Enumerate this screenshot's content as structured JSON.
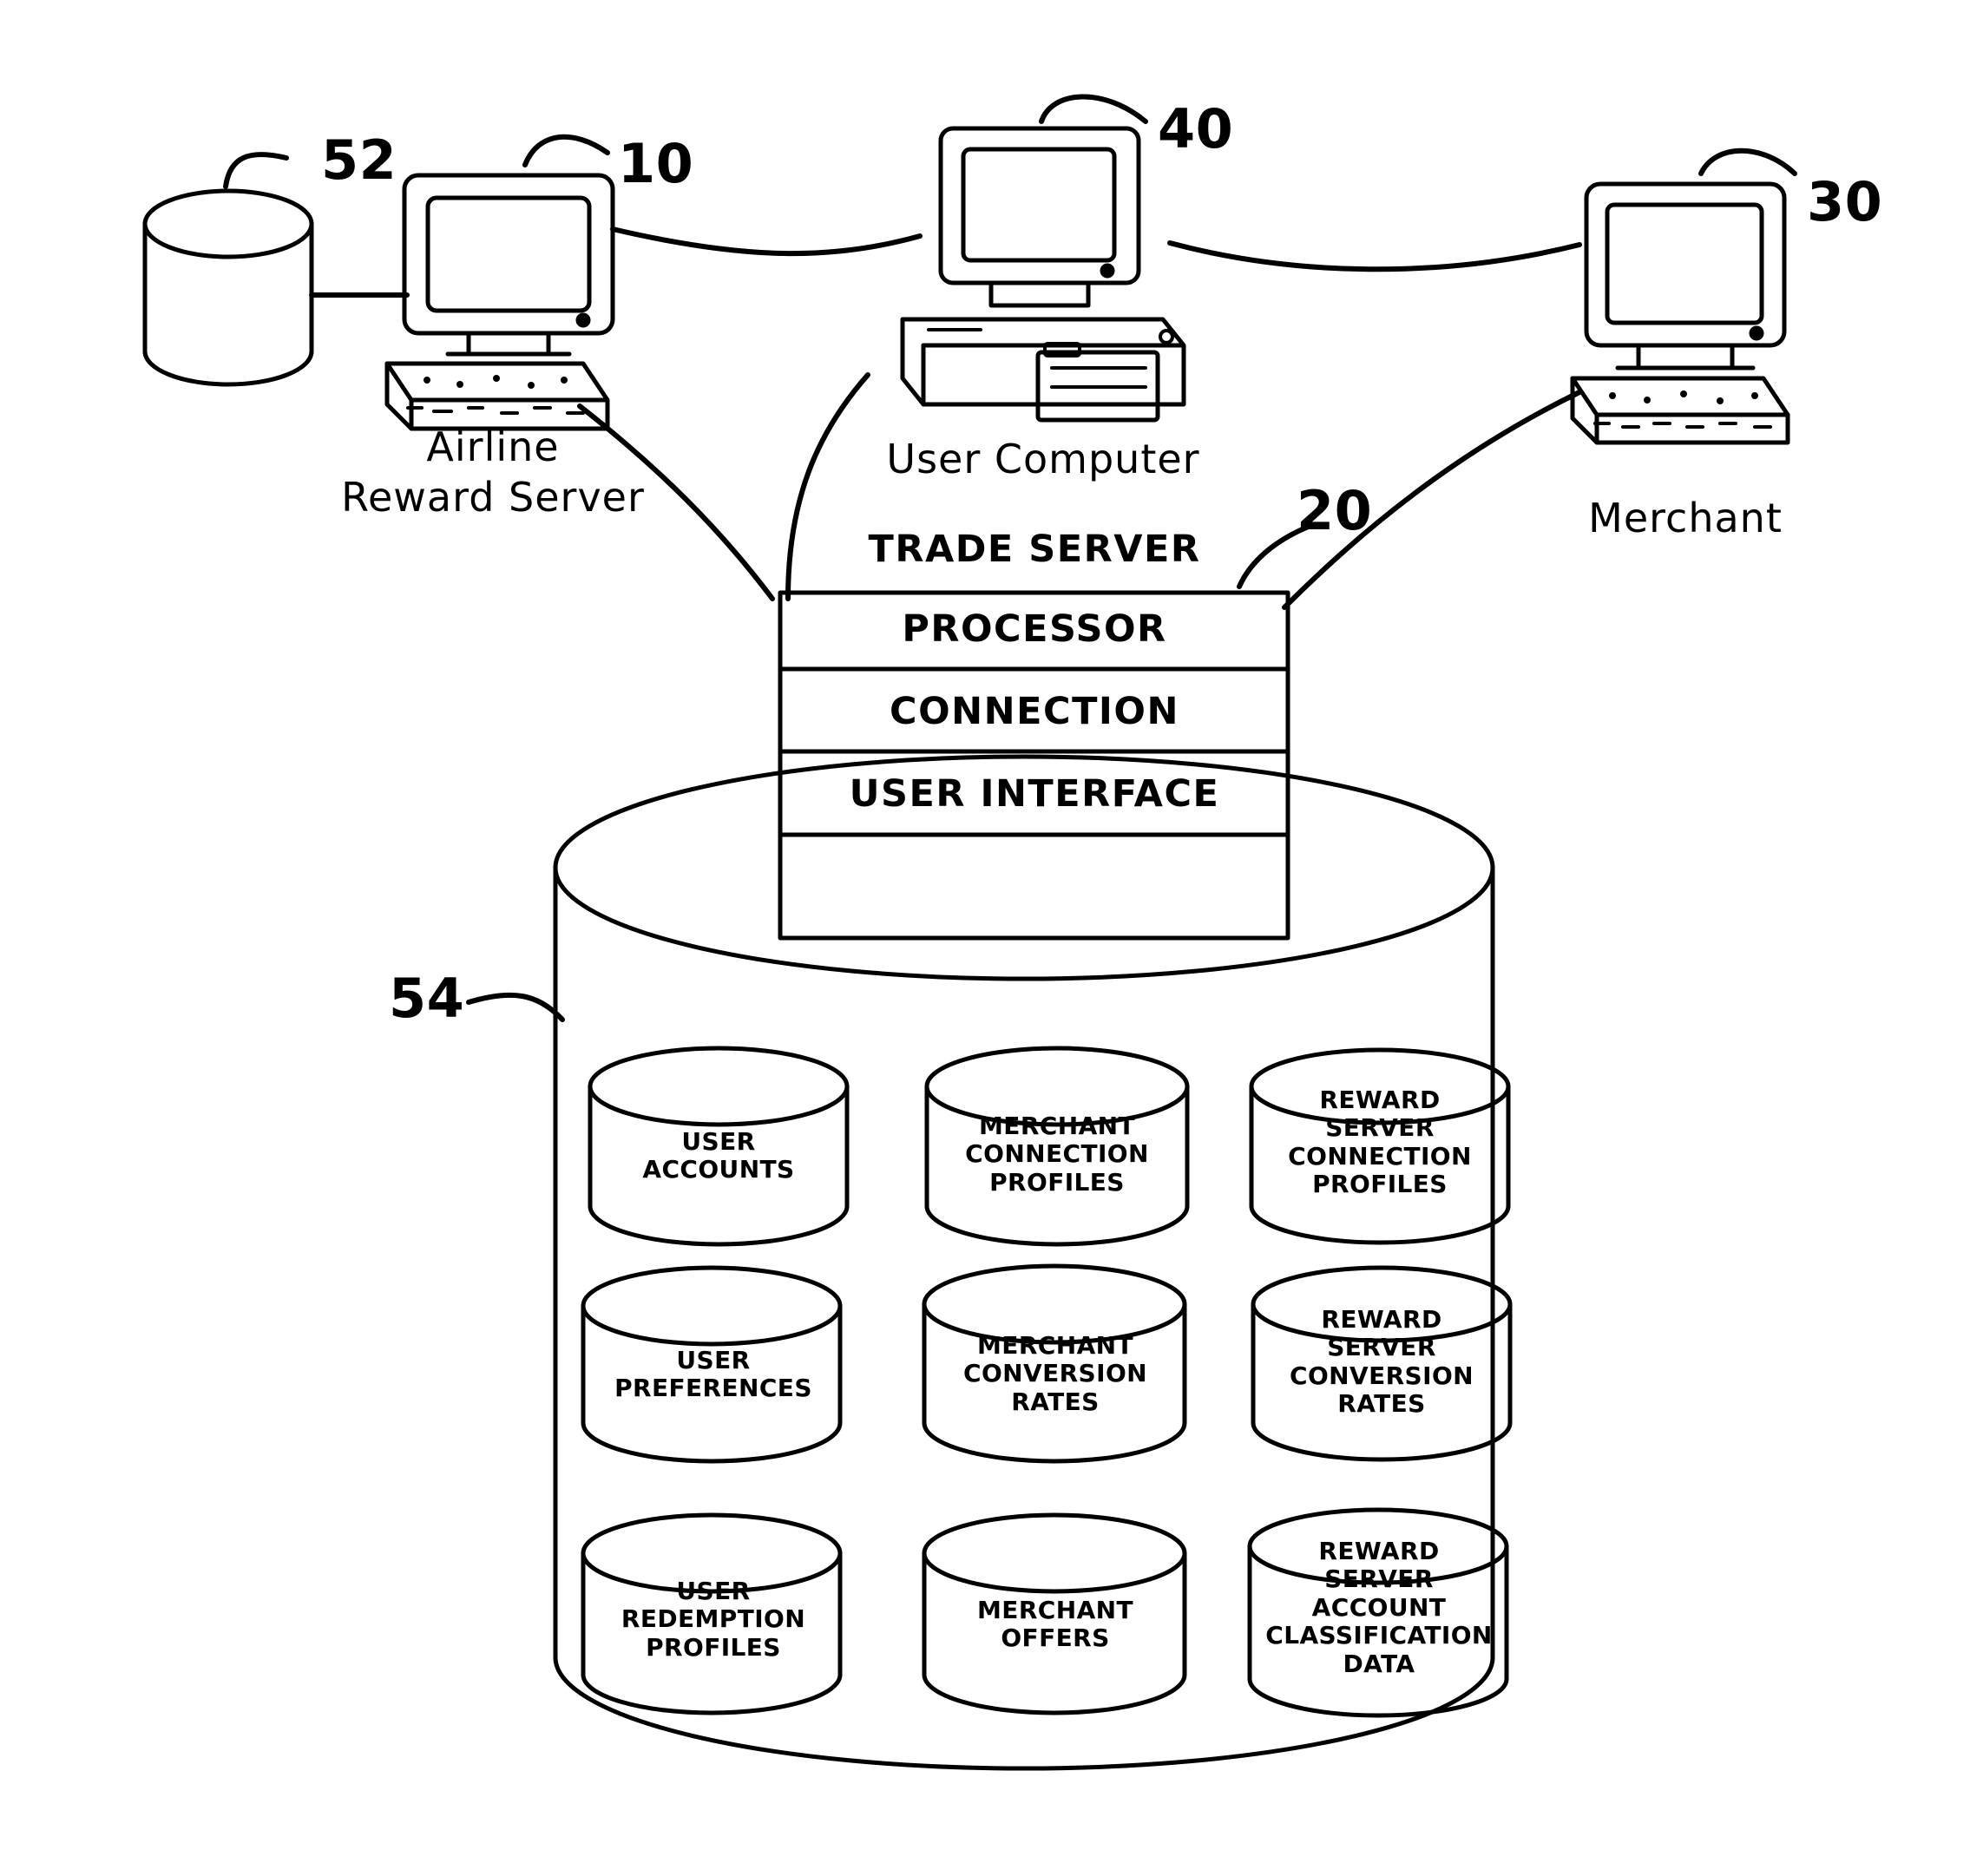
{
  "figure": {
    "type": "patent-system-diagram",
    "nodes": [
      {
        "id": "airline_db",
        "ref": "52",
        "label": "",
        "shape": "database-cylinder"
      },
      {
        "id": "airline_server",
        "ref": "10",
        "label": "Airline\nReward Server",
        "shape": "desktop-computer"
      },
      {
        "id": "user_computer",
        "ref": "40",
        "label": "User Computer",
        "shape": "tower-computer"
      },
      {
        "id": "merchant",
        "ref": "30",
        "label": "Merchant",
        "shape": "desktop-computer"
      },
      {
        "id": "trade_server",
        "ref": "20",
        "label": "TRADE SERVER",
        "shape": "stacked-box"
      },
      {
        "id": "trade_db",
        "ref": "54",
        "label": "",
        "shape": "large-database-cylinder"
      }
    ]
  },
  "refs": {
    "airline_db": "52",
    "airline_server": "10",
    "user_computer": "40",
    "merchant": "30",
    "trade_server": "20",
    "trade_database": "54"
  },
  "device_labels": {
    "airline_reward_server_line1": "Airline",
    "airline_reward_server_line2": "Reward Server",
    "user_computer": "User Computer",
    "merchant": "Merchant"
  },
  "trade_server": {
    "title": "TRADE SERVER",
    "rows": [
      "PROCESSOR",
      "CONNECTION",
      "USER INTERFACE"
    ]
  },
  "database_stores": [
    {
      "id": "user-accounts",
      "lines": [
        "USER",
        "ACCOUNTS"
      ]
    },
    {
      "id": "merchant-connection-profiles",
      "lines": [
        "MERCHANT",
        "CONNECTION",
        "PROFILES"
      ]
    },
    {
      "id": "reward-server-connection-profiles",
      "lines": [
        "REWARD",
        "SERVER",
        "CONNECTION",
        "PROFILES"
      ]
    },
    {
      "id": "user-preferences",
      "lines": [
        "USER",
        "PREFERENCES"
      ]
    },
    {
      "id": "merchant-conversion-rates",
      "lines": [
        "MERCHANT",
        "CONVERSION",
        "RATES"
      ]
    },
    {
      "id": "reward-server-conversion-rates",
      "lines": [
        "REWARD",
        "SERVER",
        "CONVERSION",
        "RATES"
      ]
    },
    {
      "id": "user-redemption-profiles",
      "lines": [
        "USER",
        "REDEMPTION",
        "PROFILES"
      ]
    },
    {
      "id": "merchant-offers",
      "lines": [
        "MERCHANT",
        "OFFERS"
      ]
    },
    {
      "id": "reward-server-account-classification-data",
      "lines": [
        "REWARD",
        "SERVER",
        "ACCOUNT",
        "CLASSIFICATION",
        "DATA"
      ]
    }
  ],
  "colors": {
    "ink": "#000000",
    "paper": "#ffffff"
  }
}
